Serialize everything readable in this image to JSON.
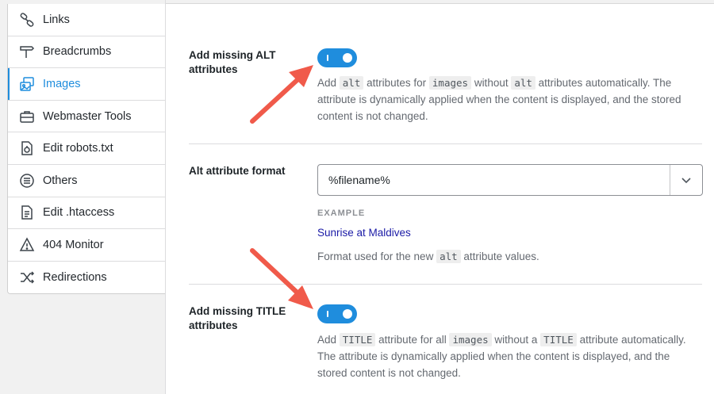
{
  "sidebar": {
    "items": [
      {
        "label": "Links",
        "icon": "link-icon"
      },
      {
        "label": "Breadcrumbs",
        "icon": "signpost-icon"
      },
      {
        "label": "Images",
        "icon": "images-icon",
        "active": true
      },
      {
        "label": "Webmaster Tools",
        "icon": "briefcase-icon"
      },
      {
        "label": "Edit robots.txt",
        "icon": "robot-file-icon"
      },
      {
        "label": "Others",
        "icon": "list-circle-icon"
      },
      {
        "label": "Edit .htaccess",
        "icon": "document-icon"
      },
      {
        "label": "404 Monitor",
        "icon": "warning-icon"
      },
      {
        "label": "Redirections",
        "icon": "shuffle-icon"
      }
    ]
  },
  "settings": {
    "alt": {
      "label": "Add missing ALT attributes",
      "enabled": true,
      "desc": {
        "t1": "Add ",
        "c1": "alt",
        "t2": " attributes for ",
        "c2": "images",
        "t3": " without ",
        "c3": "alt",
        "t4": " attributes automatically. The attribute is dynamically applied when the content is displayed, and the stored content is not changed."
      }
    },
    "format": {
      "label": "Alt attribute format",
      "value": "%filename%",
      "example_heading": "EXAMPLE",
      "example_value": "Sunrise at Maldives",
      "desc": {
        "t1": "Format used for the new ",
        "c1": "alt",
        "t2": " attribute values."
      }
    },
    "title": {
      "label": "Add missing TITLE attributes",
      "enabled": true,
      "desc": {
        "t1": "Add ",
        "c1": "TITLE",
        "t2": " attribute for all ",
        "c2": "images",
        "t3": " without a ",
        "c3": "TITLE",
        "t4": " attribute automatically. The attribute is dynamically applied when the content is displayed, and the stored content is not changed."
      }
    }
  },
  "colors": {
    "accent": "#1f8ddd",
    "annotation_arrow": "#f05a4a",
    "example_link": "#1a1aa6"
  }
}
